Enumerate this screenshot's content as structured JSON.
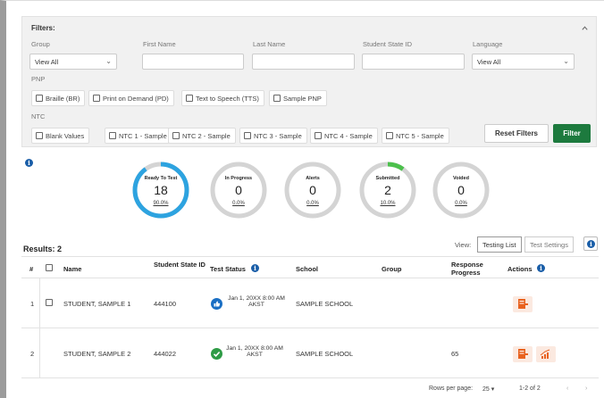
{
  "filters": {
    "title": "Filters:",
    "collapse_icon": "chevron-up-icon",
    "group": {
      "label": "Group",
      "value": "View All"
    },
    "first_name": {
      "label": "First Name",
      "value": ""
    },
    "last_name": {
      "label": "Last Name",
      "value": ""
    },
    "student_state_id": {
      "label": "Student State ID",
      "value": ""
    },
    "language": {
      "label": "Language",
      "value": "View All"
    },
    "pnp": {
      "label": "PNP",
      "options": [
        "Braille (BR)",
        "Print on Demand (PD)",
        "Text to Speech (TTS)",
        "Sample PNP"
      ]
    },
    "ntc": {
      "label": "NTC",
      "options": [
        "Blank Values",
        "NTC 1 - Sample",
        "NTC 2 - Sample",
        "NTC 3 - Sample",
        "NTC 4 - Sample",
        "NTC 5 - Sample"
      ]
    },
    "reset_label": "Reset Filters",
    "filter_label": "Filter"
  },
  "summary": {
    "colors": {
      "track": "#d4d4d4",
      "ready": "#2da3e0",
      "submitted": "#4cc04c"
    },
    "cards": [
      {
        "label": "Ready To Test",
        "count": "18",
        "percent": "90.0%",
        "fraction": 0.9
      },
      {
        "label": "In Progress",
        "count": "0",
        "percent": "0.0%",
        "fraction": 0
      },
      {
        "label": "Alerts",
        "count": "0",
        "percent": "0.0%",
        "fraction": 0
      },
      {
        "label": "Submitted",
        "count": "2",
        "percent": "10.0%",
        "fraction": 0.1
      },
      {
        "label": "Voided",
        "count": "0",
        "percent": "0.0%",
        "fraction": 0
      }
    ]
  },
  "results": {
    "title": "Results: 2",
    "view_label": "View:",
    "view_options": [
      "Testing List",
      "Test Settings"
    ],
    "columns": [
      "#",
      "Name",
      "Student State ID",
      "Test Status",
      "School",
      "Group",
      "Response Progress",
      "Actions"
    ],
    "rows": [
      {
        "num": "1",
        "name": "STUDENT, SAMPLE 1",
        "ssid": "444100",
        "status": "Jan 1, 20XX 8:00 AM AKST",
        "status_icon": "thumbs-up-icon",
        "school": "SAMPLE SCHOOL",
        "group": "",
        "progress": ""
      },
      {
        "num": "2",
        "name": "STUDENT, SAMPLE 2",
        "ssid": "444022",
        "status": "Jan 1, 20XX 8:00 AM AKST",
        "status_icon": "check-circle-icon",
        "school": "SAMPLE SCHOOL",
        "group": "",
        "progress": "65"
      }
    ],
    "pager": {
      "rows_per_page_label": "Rows per page:",
      "rows_per_page": "25",
      "range": "1-2 of 2"
    }
  }
}
